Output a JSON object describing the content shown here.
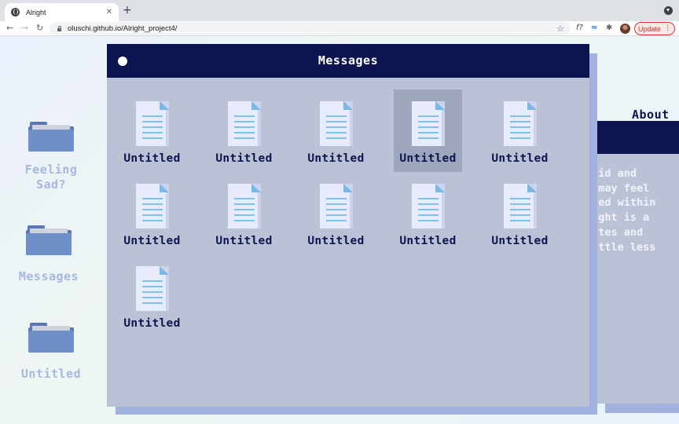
{
  "browser": {
    "tab_title": "Alright",
    "tab_close": "✕",
    "new_tab": "+",
    "url": "oluschi.github.io/Alright_project4/",
    "back": "←",
    "forward": "→",
    "reload": "↻",
    "star": "☆",
    "ext_f": "f?",
    "ext_wave": "≈",
    "ext_puzzle": "✱",
    "update_label": "Update",
    "update_dots": "⋮"
  },
  "desktop": {
    "icons": [
      {
        "label_line1": "Feeling",
        "label_line2": "Sad?"
      },
      {
        "label_line1": "Messages",
        "label_line2": ""
      },
      {
        "label_line1": "Untitled",
        "label_line2": ""
      }
    ]
  },
  "about": {
    "title": "About",
    "lines": [
      "said and",
      "u may feel",
      "ened within",
      "right is a",
      "notes and",
      "little less"
    ]
  },
  "messages_window": {
    "title": "Messages",
    "files": [
      {
        "label": "Untitled",
        "selected": false
      },
      {
        "label": "Untitled",
        "selected": false
      },
      {
        "label": "Untitled",
        "selected": false
      },
      {
        "label": "Untitled",
        "selected": true
      },
      {
        "label": "Untitled",
        "selected": false
      },
      {
        "label": "Untitled",
        "selected": false
      },
      {
        "label": "Untitled",
        "selected": false
      },
      {
        "label": "Untitled",
        "selected": false
      },
      {
        "label": "Untitled",
        "selected": false
      },
      {
        "label": "Untitled",
        "selected": false
      },
      {
        "label": "Untitled",
        "selected": false
      }
    ]
  },
  "colors": {
    "navy": "#0c1550",
    "window_bg": "#bcc2d5",
    "window_shadow": "#9fb1dc",
    "folder_blue": "#6f8fc9",
    "desktop_label": "#a6b7e0",
    "update_red": "#d93025"
  }
}
